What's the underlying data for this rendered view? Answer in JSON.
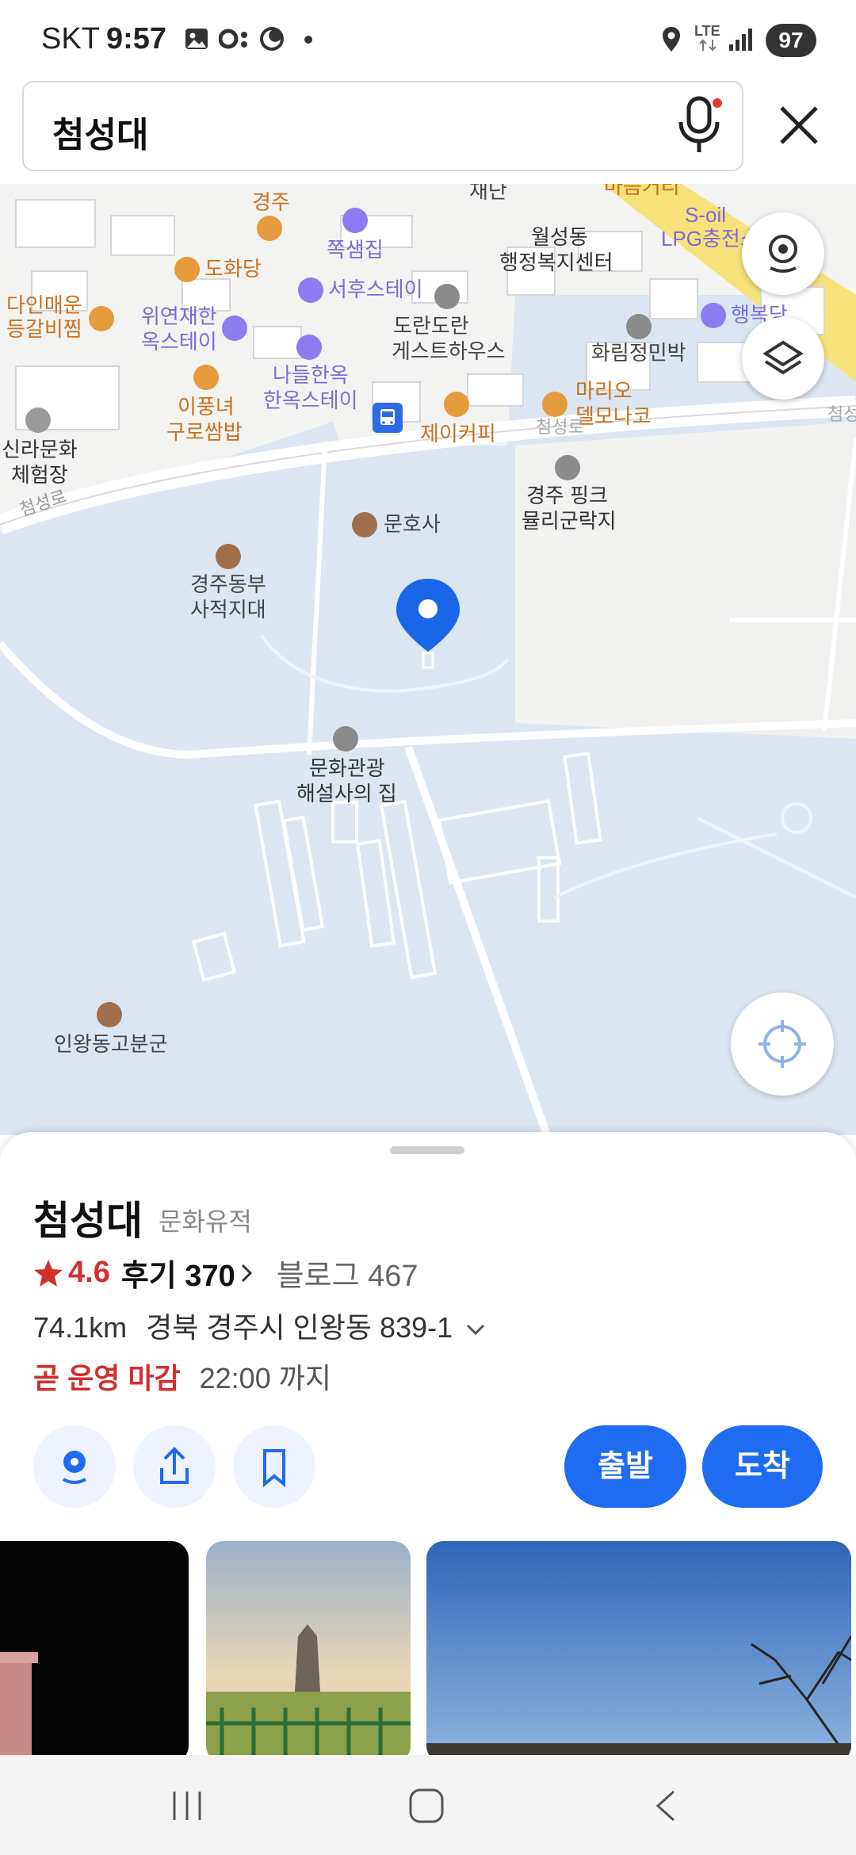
{
  "status_bar": {
    "carrier": "SKT",
    "time": "9:57",
    "network": "LTE",
    "battery": "97"
  },
  "search": {
    "query": "첨성대"
  },
  "map": {
    "pois": {
      "gyeongju": "경주",
      "dohwadang": "도화당",
      "jjoksaem": "쪽샘집",
      "seohu": "서후스테이",
      "wolseong_1": "월성동",
      "wolseong_2": "행정복지센터",
      "soil_1": "S-oil",
      "soil_2": "LPG충전소",
      "daein_1": "다인매운",
      "daein_2": "등갈비찜",
      "wiyeon_1": "위연재한",
      "wiyeon_2": "옥스테이",
      "doran_1": "도란도란",
      "doran_2": "게스트하우스",
      "hwarim": "화림정민박",
      "haengbok": "행복당",
      "nadeul_1": "나들한옥",
      "nadeul_2": "한옥스테이",
      "ipung_1": "이풍녀",
      "ipung_2": "구로쌈밥",
      "mario_1": "마리오",
      "mario_2": "델모나코",
      "jcoffee": "제이커피",
      "cheomseong_road_top": "첨성로",
      "cheomseong_right": "첨성",
      "silla_1": "신라문화",
      "silla_2": "체험장",
      "cheomseong_road_left": "첨성로",
      "pink_1": "경주 핑크",
      "pink_2": "뮬리군락지",
      "munho": "문호사",
      "dongbu_1": "경주동부",
      "dongbu_2": "사적지대",
      "munhwa_1": "문화관광",
      "munhwa_2": "해설사의 집",
      "inwang": "인왕동고분군",
      "top_partial_1": "재단",
      "top_partial_2": "마음거리"
    }
  },
  "place": {
    "name": "첨성대",
    "category": "문화유적",
    "rating": "4.6",
    "reviews_label": "후기 370",
    "blog_label": "블로그 467",
    "distance": "74.1km",
    "address": "경북 경주시 인왕동 839-1",
    "hours_status": "곧 운영 마감",
    "hours_time": "22:00 까지",
    "depart_label": "출발",
    "arrive_label": "도착"
  },
  "colors": {
    "accent": "#1f6bf1",
    "pin": "#1a66e8",
    "star": "#d42e2e",
    "water": "#dbe6f2",
    "road_yellow": "#f6e27a"
  }
}
